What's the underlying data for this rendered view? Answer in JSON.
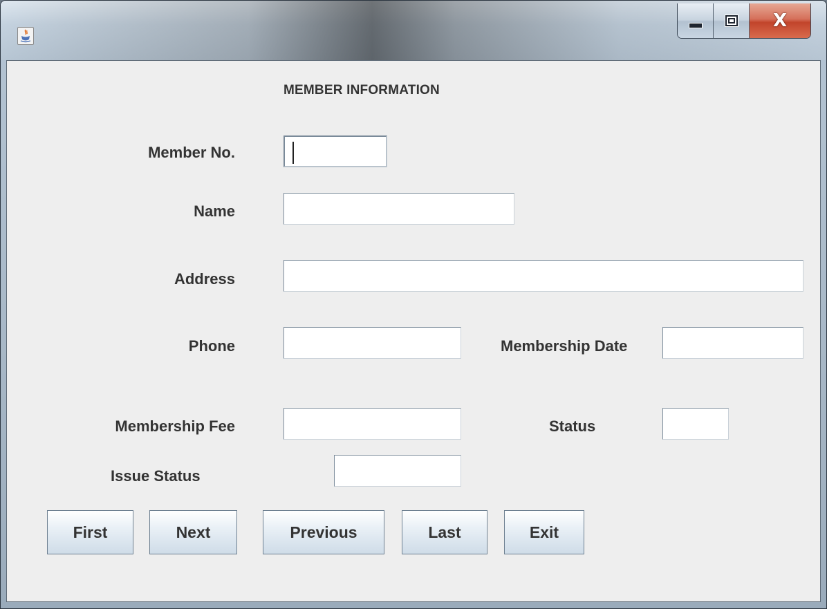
{
  "window": {
    "controls": {
      "minimize_icon": "minimize-icon",
      "maximize_icon": "maximize-icon",
      "close_label": "X"
    },
    "app_icon": "java-cup-icon"
  },
  "form": {
    "heading": "MEMBER INFORMATION",
    "fields": {
      "member_no": {
        "label": "Member No.",
        "value": ""
      },
      "name": {
        "label": "Name",
        "value": ""
      },
      "address": {
        "label": "Address",
        "value": ""
      },
      "phone": {
        "label": "Phone",
        "value": ""
      },
      "membership_date": {
        "label": "Membership Date",
        "value": ""
      },
      "membership_fee": {
        "label": "Membership Fee",
        "value": ""
      },
      "status": {
        "label": "Status",
        "value": ""
      },
      "issue_status": {
        "label": "Issue Status",
        "value": ""
      }
    }
  },
  "buttons": {
    "first": "First",
    "next": "Next",
    "previous": "Previous",
    "last": "Last",
    "exit": "Exit"
  },
  "colors": {
    "close_button": "#c2442b",
    "content_background": "#eeeeee"
  }
}
